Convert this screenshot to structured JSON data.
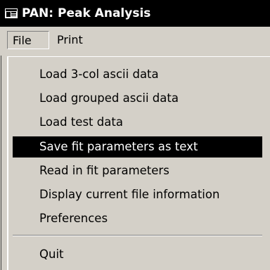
{
  "window": {
    "title": "PAN: Peak Analysis",
    "icon": "app-window-icon"
  },
  "menubar": {
    "file_label": "File",
    "print_label": "Print"
  },
  "file_menu": {
    "items": [
      "Load 3-col ascii data",
      "Load grouped ascii data",
      "Load test data",
      "Save fit parameters as text",
      "Read in fit parameters",
      "Display current file information",
      "Preferences"
    ],
    "highlighted": "Save fit parameters as text",
    "quit_label": "Quit"
  }
}
